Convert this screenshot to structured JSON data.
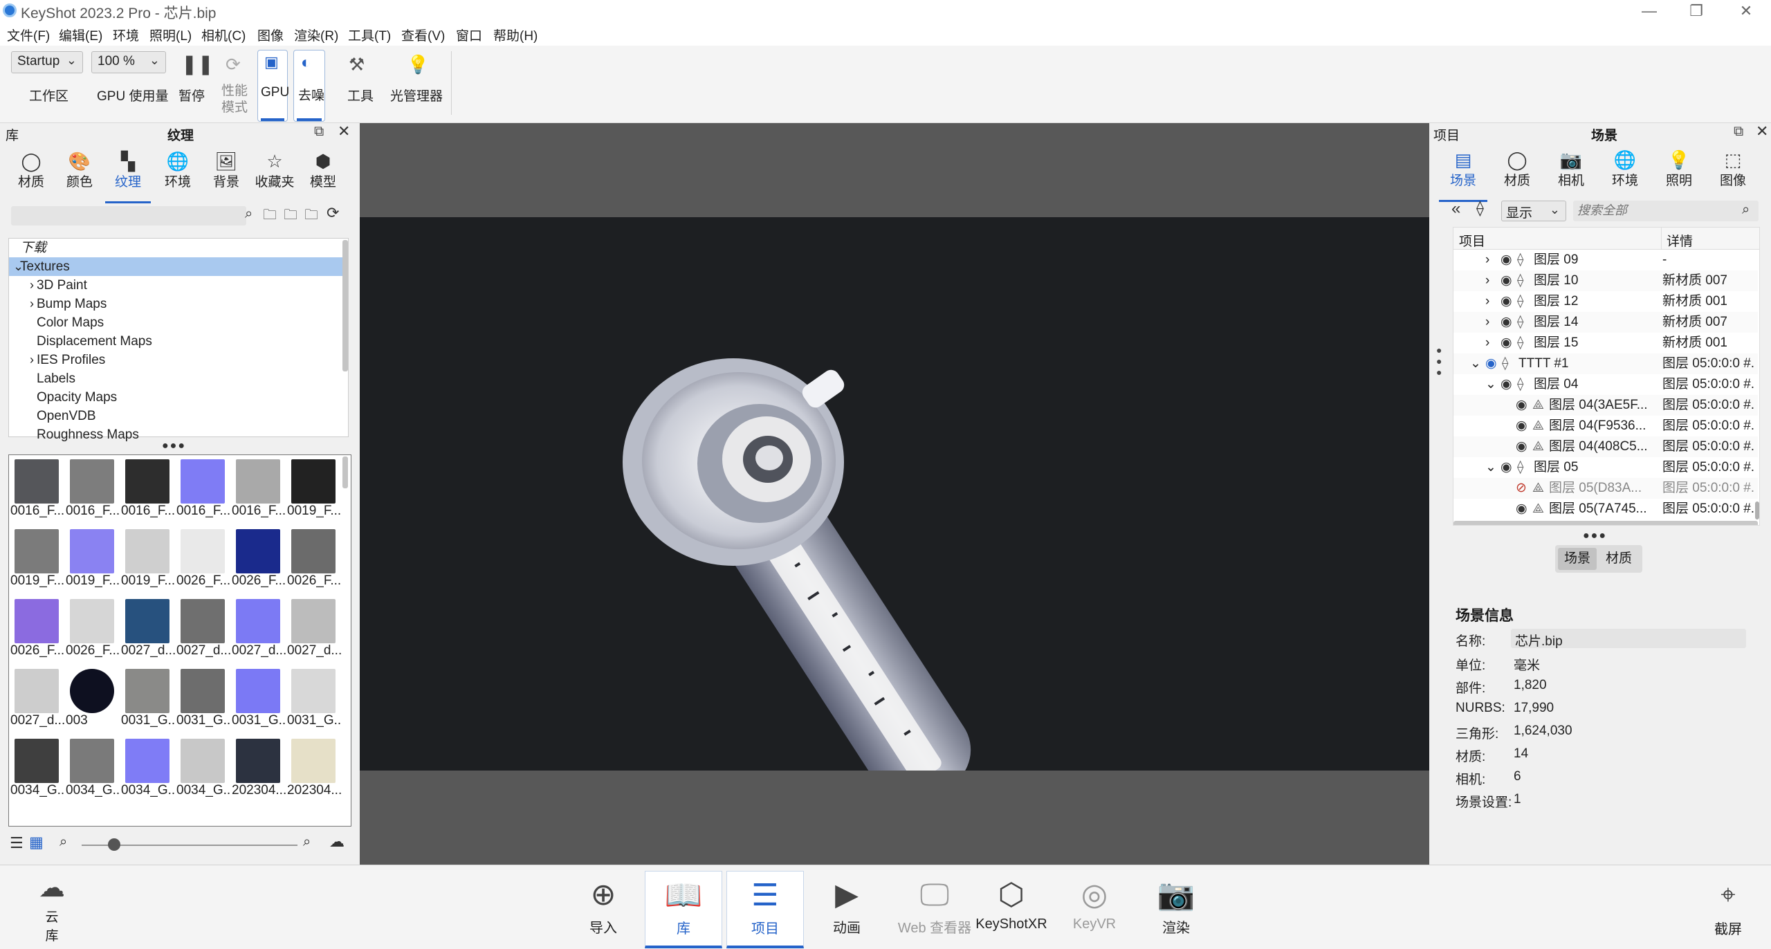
{
  "window": {
    "title": "KeyShot 2023.2 Pro  - 芯片.bip",
    "minimize": "—",
    "restore": "❐",
    "close": "✕"
  },
  "menu": [
    "文件(F)",
    "编辑(E)",
    "环境",
    "照明(L)",
    "相机(C)",
    "图像",
    "渲染(R)",
    "工具(T)",
    "查看(V)",
    "窗口",
    "帮助(H)"
  ],
  "toolbar": {
    "workspace_select": "Startup",
    "workspace_label": "工作区",
    "gpu_usage_select": "100 %",
    "gpu_usage_label": "GPU 使用量",
    "pause_label": "暂停",
    "perf_label": "性能\n模式",
    "perf_line1": "性能",
    "perf_line2": "模式",
    "gpu_label": "GPU",
    "denoise_label": "去噪",
    "tools_label": "工具",
    "light_manager_label": "光管理器"
  },
  "library": {
    "panel_title": "库",
    "panel_subtitle": "纹理",
    "tabs": [
      "材质",
      "颜色",
      "纹理",
      "环境",
      "背景",
      "收藏夹",
      "模型"
    ],
    "active_tab": "纹理",
    "tree": [
      {
        "label": "下载",
        "indent": 0,
        "expander": "",
        "italic": true
      },
      {
        "label": "Textures",
        "indent": 0,
        "expander": "⌄",
        "selected": true
      },
      {
        "label": "3D Paint",
        "indent": 1,
        "expander": "›"
      },
      {
        "label": "Bump Maps",
        "indent": 1,
        "expander": "›"
      },
      {
        "label": "Color Maps",
        "indent": 1,
        "expander": ""
      },
      {
        "label": "Displacement Maps",
        "indent": 1,
        "expander": ""
      },
      {
        "label": "IES Profiles",
        "indent": 1,
        "expander": "›"
      },
      {
        "label": "Labels",
        "indent": 1,
        "expander": ""
      },
      {
        "label": "Opacity Maps",
        "indent": 1,
        "expander": ""
      },
      {
        "label": "OpenVDB",
        "indent": 1,
        "expander": ""
      },
      {
        "label": "Roughness Maps",
        "indent": 1,
        "expander": ""
      }
    ],
    "thumbnails": [
      {
        "cap": "0016_F...",
        "color": "#55565a"
      },
      {
        "cap": "0016_F...",
        "color": "#7d7d7d"
      },
      {
        "cap": "0016_F...",
        "color": "#2d2d2d"
      },
      {
        "cap": "0016_F...",
        "color": "#7f7cf5"
      },
      {
        "cap": "0016_F...",
        "color": "#a9a9a9"
      },
      {
        "cap": "0019_F...",
        "color": "#222222"
      },
      {
        "cap": "0019_F...",
        "color": "#7b7b7b"
      },
      {
        "cap": "0019_F...",
        "color": "#8a82f2"
      },
      {
        "cap": "0019_F...",
        "color": "#cfcfcf"
      },
      {
        "cap": "0026_F...",
        "color": "#e9e9e9"
      },
      {
        "cap": "0026_F...",
        "color": "#1a2a8c"
      },
      {
        "cap": "0026_F...",
        "color": "#6b6b6b"
      },
      {
        "cap": "0026_F...",
        "color": "#8b6be0"
      },
      {
        "cap": "0026_F...",
        "color": "#d6d6d6"
      },
      {
        "cap": "0027_d...",
        "color": "#27517e"
      },
      {
        "cap": "0027_d...",
        "color": "#6f6f6f"
      },
      {
        "cap": "0027_d...",
        "color": "#7c7af4"
      },
      {
        "cap": "0027_d...",
        "color": "#bcbcbc"
      },
      {
        "cap": "0027_d...",
        "color": "#cdcdcd"
      },
      {
        "cap": "003",
        "color": "#0e1020"
      },
      {
        "cap": "0031_G...",
        "color": "#8a8a88"
      },
      {
        "cap": "0031_G...",
        "color": "#6d6d6d"
      },
      {
        "cap": "0031_G...",
        "color": "#7b79f5"
      },
      {
        "cap": "0031_G...",
        "color": "#d8d8d8"
      },
      {
        "cap": "0034_G...",
        "color": "#3f3f3f"
      },
      {
        "cap": "0034_G...",
        "color": "#7a7a7a"
      },
      {
        "cap": "0034_G...",
        "color": "#7f7cf6"
      },
      {
        "cap": "0034_G...",
        "color": "#c8c8c8"
      },
      {
        "cap": "202304...",
        "color": "#2c3240"
      },
      {
        "cap": "202304...",
        "color": "#e6e0c8"
      }
    ]
  },
  "project": {
    "panel_title": "项目",
    "panel_subtitle": "场景",
    "tabs": [
      "场景",
      "材质",
      "相机",
      "环境",
      "照明",
      "图像"
    ],
    "active_tab": "场景",
    "display_select": "显示",
    "search_placeholder": "搜索全部",
    "col_item": "项目",
    "col_detail": "详情",
    "rows": [
      {
        "name": "图层 09",
        "detail": "-",
        "indent": 1,
        "expander": "›"
      },
      {
        "name": "图层 10",
        "detail": "新材质 007",
        "indent": 1,
        "expander": "›"
      },
      {
        "name": "图层 12",
        "detail": "新材质 001",
        "indent": 1,
        "expander": "›"
      },
      {
        "name": "图层 14",
        "detail": "新材质 007",
        "indent": 1,
        "expander": "›"
      },
      {
        "name": "图层 15",
        "detail": "新材质 001",
        "indent": 1,
        "expander": "›"
      },
      {
        "name": "TTTT #1",
        "detail": "图层 05:0:0:0 #.",
        "indent": 0,
        "expander": "⌄"
      },
      {
        "name": "图层 04",
        "detail": "图层 05:0:0:0 #.",
        "indent": 1,
        "expander": "⌄"
      },
      {
        "name": "图层 04(3AE5F...",
        "detail": "图层 05:0:0:0 #.",
        "indent": 2,
        "expander": ""
      },
      {
        "name": "图层 04(F9536...",
        "detail": "图层 05:0:0:0 #.",
        "indent": 2,
        "expander": ""
      },
      {
        "name": "图层 04(408C5...",
        "detail": "图层 05:0:0:0 #.",
        "indent": 2,
        "expander": ""
      },
      {
        "name": "图层 05",
        "detail": "图层 05:0:0:0 #.",
        "indent": 1,
        "expander": "⌄"
      },
      {
        "name": "图层 05(D83A...",
        "detail": "图层 05:0:0:0 #.",
        "indent": 2,
        "expander": "",
        "hidden": true
      },
      {
        "name": "图层 05(7A745...",
        "detail": "图层 05:0:0:0 #.",
        "indent": 2,
        "expander": ""
      }
    ],
    "sub_tabs": [
      "场景",
      "材质"
    ],
    "info": {
      "title": "场景信息",
      "name_label": "名称:",
      "name_value": "芯片.bip",
      "unit_label": "单位:",
      "unit_value": "毫米",
      "parts_label": "部件:",
      "parts_value": "1,820",
      "nurbs_label": "NURBS:",
      "nurbs_value": "17,990",
      "tris_label": "三角形:",
      "tris_value": "1,624,030",
      "materials_label": "材质:",
      "materials_value": "14",
      "cameras_label": "相机:",
      "cameras_value": "6",
      "scene_settings_label": "场景设置:",
      "scene_settings_value": "1"
    }
  },
  "bottombar": {
    "cloud_label_1": "云",
    "cloud_label_2": "库",
    "buttons": [
      {
        "label": "导入",
        "icon": "import-icon",
        "glyph": "⊕"
      },
      {
        "label": "库",
        "icon": "book-icon",
        "glyph": "📖",
        "active": true
      },
      {
        "label": "项目",
        "icon": "list-icon",
        "glyph": "☰",
        "active": true
      },
      {
        "label": "动画",
        "icon": "play-icon",
        "glyph": "▶"
      },
      {
        "label": "Web 查看器",
        "icon": "monitor-icon",
        "glyph": "🖵",
        "disabled": true
      },
      {
        "label": "KeyShotXR",
        "icon": "cube-icon",
        "glyph": "⬡"
      },
      {
        "label": "KeyVR",
        "icon": "vr-icon",
        "glyph": "◎",
        "disabled": true
      },
      {
        "label": "渲染",
        "icon": "camera-icon",
        "glyph": "📷"
      }
    ],
    "screenshot_label": "截屏"
  },
  "colors": {
    "accent": "#2563c9",
    "selection": "#a9c9ef",
    "viewport_bg": "#585858",
    "render_bg": "#1d1f22"
  }
}
